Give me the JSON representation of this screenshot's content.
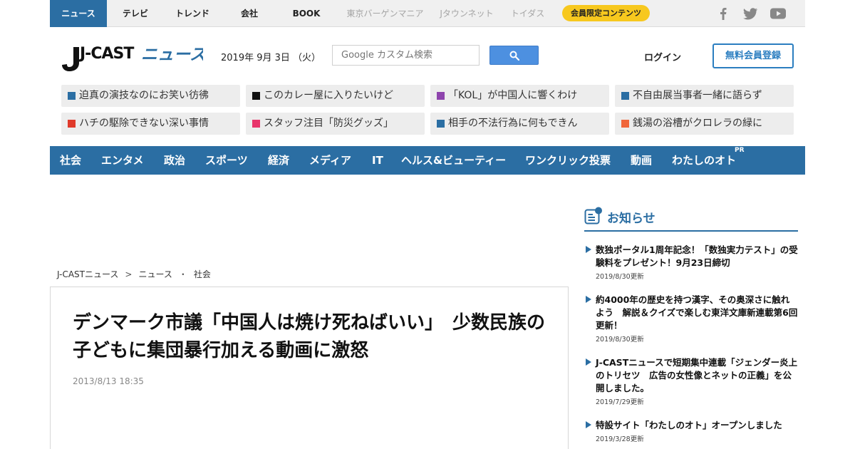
{
  "topbar": {
    "tabs": [
      {
        "label": "ニュース"
      },
      {
        "label": "テレビ"
      },
      {
        "label": "トレンド"
      },
      {
        "label": "会社"
      },
      {
        "label": "BOOK"
      },
      {
        "label": "東京バーゲンマニア"
      },
      {
        "label": "Jタウンネット"
      },
      {
        "label": "トイダス"
      }
    ],
    "member_label": "会員限定コンテンツ",
    "social_icons": [
      "facebook-icon",
      "twitter-icon",
      "youtube-icon"
    ]
  },
  "header": {
    "logo_text_left": "J-CAST",
    "logo_text_right": "ニュース",
    "date": "2019年 9月 3日 （火）",
    "search_placeholder": "Google カスタム検索",
    "login_label": "ログイン",
    "register_label": "無料会員登録"
  },
  "trends": [
    {
      "label": "迫真の演技なのにお笑い彷彿",
      "color": "#2b6ea3"
    },
    {
      "label": "このカレー屋に入りたいけど",
      "color": "#111111"
    },
    {
      "label": "「KOL」が中国人に響くわけ",
      "color": "#8e44ad"
    },
    {
      "label": "不自由展当事者一緒に語らず",
      "color": "#2b6ea3"
    },
    {
      "label": "ハチの駆除できない深い事情",
      "color": "#e03a2b"
    },
    {
      "label": "スタッフ注目「防災グッズ」",
      "color": "#e8356b"
    },
    {
      "label": "相手の不法行為に何もできん",
      "color": "#2b6ea3"
    },
    {
      "label": "銭湯の浴槽がクロレラの緑に",
      "color": "#f0663a"
    }
  ],
  "categories": [
    {
      "label": "社会"
    },
    {
      "label": "エンタメ"
    },
    {
      "label": "政治"
    },
    {
      "label": "スポーツ"
    },
    {
      "label": "経済"
    },
    {
      "label": "メディア"
    },
    {
      "label": "IT"
    },
    {
      "label": "ヘルス&ビューティー"
    },
    {
      "label": "ワンクリック投票"
    },
    {
      "label": "動画"
    },
    {
      "label": "わたしのオト"
    }
  ],
  "pr_label": "PR",
  "breadcrumb": {
    "items": [
      "J-CASTニュース",
      "ニュース",
      "社会"
    ],
    "separators": [
      ">",
      "・"
    ]
  },
  "article": {
    "title": "デンマーク市議「中国人は焼け死ねばいい」　少数民族の子どもに集団暴行加える動画に激怒",
    "date": "2013/8/13 18:35"
  },
  "sidebar": {
    "heading": "お知らせ",
    "news": [
      {
        "text": "数独ポータル1周年記念！「数独実力テスト」の受験料をプレゼント！9月23日締切",
        "updated": "2019/8/30更新"
      },
      {
        "text": "約4000年の歴史を持つ漢字、その奥深さに触れよう　解説＆クイズで楽しむ東洋文庫新連載第6回更新！",
        "updated": "2019/8/30更新"
      },
      {
        "text": "J-CASTニュースで短期集中連載「ジェンダー炎上のトリセツ　広告の女性像とネットの正義」を公開しました。",
        "updated": "2019/7/29更新"
      },
      {
        "text": "特設サイト「わたしのオト」オープンしました",
        "updated": "2019/3/28更新"
      }
    ]
  },
  "colors": {
    "brand_blue": "#2b6ea3",
    "member_yellow": "#f7c81e",
    "search_blue": "#4d90e0"
  }
}
